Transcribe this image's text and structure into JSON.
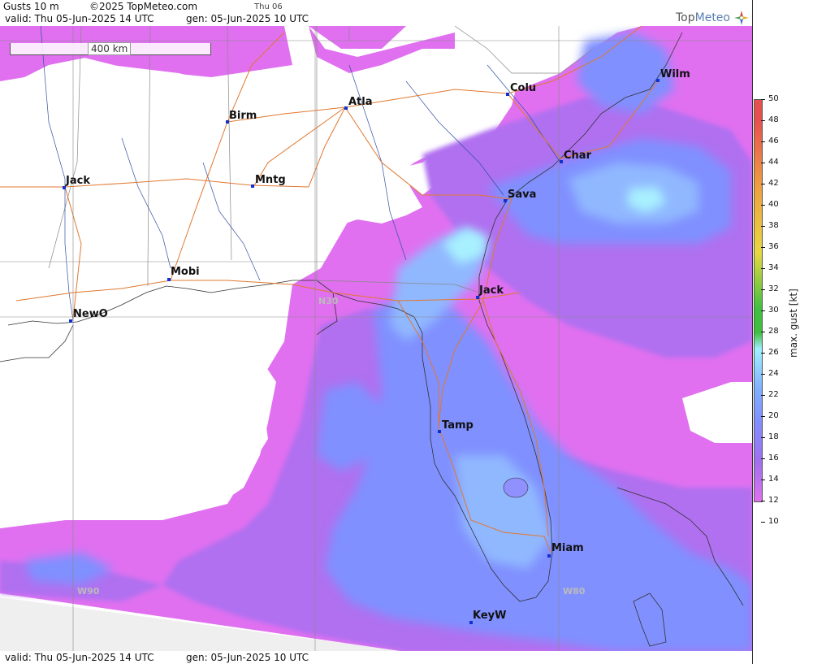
{
  "header": {
    "product": "Gusts 10 m",
    "copyright": "©2025 TopMeteo.com",
    "next_day": "Thu 06",
    "valid": "valid:  Thu  05-Jun-2025  14 UTC",
    "generated": "gen: 05-Jun-2025 10 UTC"
  },
  "footer": {
    "valid": "valid:  Thu  05-Jun-2025  14 UTC",
    "generated": "gen: 05-Jun-2025 10 UTC"
  },
  "logo": {
    "part1": "Top",
    "part2": "Meteo"
  },
  "scale": {
    "label": "400 km"
  },
  "legend": {
    "title": "max. gust [kt]",
    "ticks": [
      "50",
      "48",
      "46",
      "44",
      "42",
      "40",
      "38",
      "36",
      "34",
      "32",
      "30",
      "28",
      "26",
      "24",
      "22",
      "20",
      "18",
      "16",
      "14",
      "12",
      "10"
    ],
    "colors": {
      "high": "#e85050",
      "mid_orange": "#f0a040",
      "yellow": "#e8d840",
      "green": "#40c040",
      "cyan": "#a0f0ff",
      "light_blue": "#80b0ff",
      "blue": "#8090ff",
      "violet": "#a070f0",
      "magenta": "#e070f0"
    }
  },
  "cities": [
    {
      "id": "wilm",
      "name": "Wilm"
    },
    {
      "id": "colu",
      "name": "Colu"
    },
    {
      "id": "atla",
      "name": "Atla"
    },
    {
      "id": "birm",
      "name": "Birm"
    },
    {
      "id": "char",
      "name": "Char"
    },
    {
      "id": "sava",
      "name": "Sava"
    },
    {
      "id": "jack-ms",
      "name": "Jack"
    },
    {
      "id": "mntg",
      "name": "Mntg"
    },
    {
      "id": "mobi",
      "name": "Mobi"
    },
    {
      "id": "jack-fl",
      "name": "Jack"
    },
    {
      "id": "newo",
      "name": "NewO"
    },
    {
      "id": "tamp",
      "name": "Tamp"
    },
    {
      "id": "miam",
      "name": "Miam"
    },
    {
      "id": "keyw",
      "name": "KeyW"
    }
  ],
  "grid_labels": {
    "n30": "N30",
    "w90": "W90",
    "w80": "W80"
  }
}
